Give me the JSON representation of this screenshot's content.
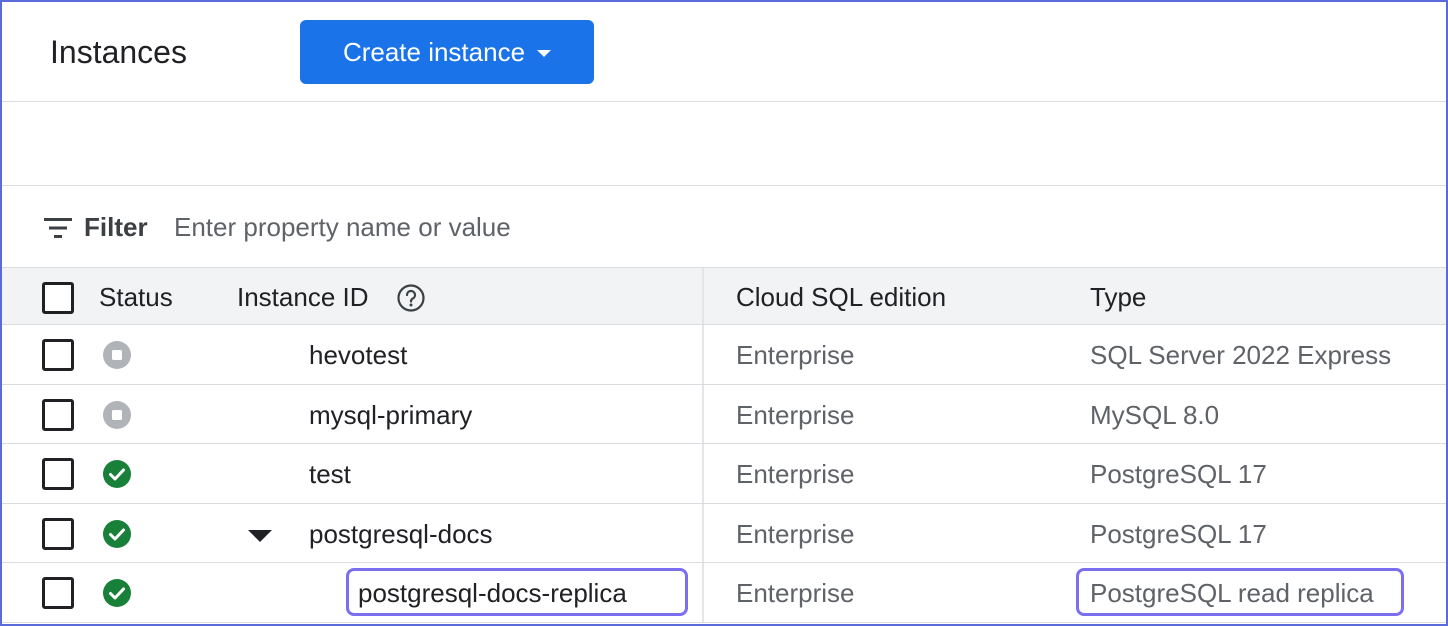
{
  "header": {
    "title": "Instances",
    "create_button_label": "Create instance"
  },
  "filter": {
    "label": "Filter",
    "placeholder": "Enter property name or value"
  },
  "table": {
    "columns": {
      "status": "Status",
      "instance_id": "Instance ID",
      "edition": "Cloud SQL edition",
      "type": "Type"
    },
    "rows": [
      {
        "status": "stopped",
        "id": "hevotest",
        "edition": "Enterprise",
        "type": "SQL Server 2022 Express"
      },
      {
        "status": "stopped",
        "id": "mysql-primary",
        "edition": "Enterprise",
        "type": "MySQL 8.0"
      },
      {
        "status": "running",
        "id": "test",
        "edition": "Enterprise",
        "type": "PostgreSQL 17"
      },
      {
        "status": "running",
        "id": "postgresql-docs",
        "edition": "Enterprise",
        "type": "PostgreSQL 17",
        "expanded": true
      },
      {
        "status": "running",
        "id": "postgresql-docs-replica",
        "edition": "Enterprise",
        "type": "PostgreSQL read replica",
        "child": true,
        "highlighted": true
      }
    ]
  },
  "colors": {
    "primary": "#1a73e8",
    "running": "#188038",
    "stopped": "#b0b3b8",
    "highlight": "#7b6ef0"
  },
  "icons": {
    "filter": "filter-icon",
    "help": "help-icon",
    "dropdown": "caret-down-icon",
    "expand": "expand-caret-icon",
    "running": "check-circle-icon",
    "stopped": "stopped-circle-icon"
  }
}
